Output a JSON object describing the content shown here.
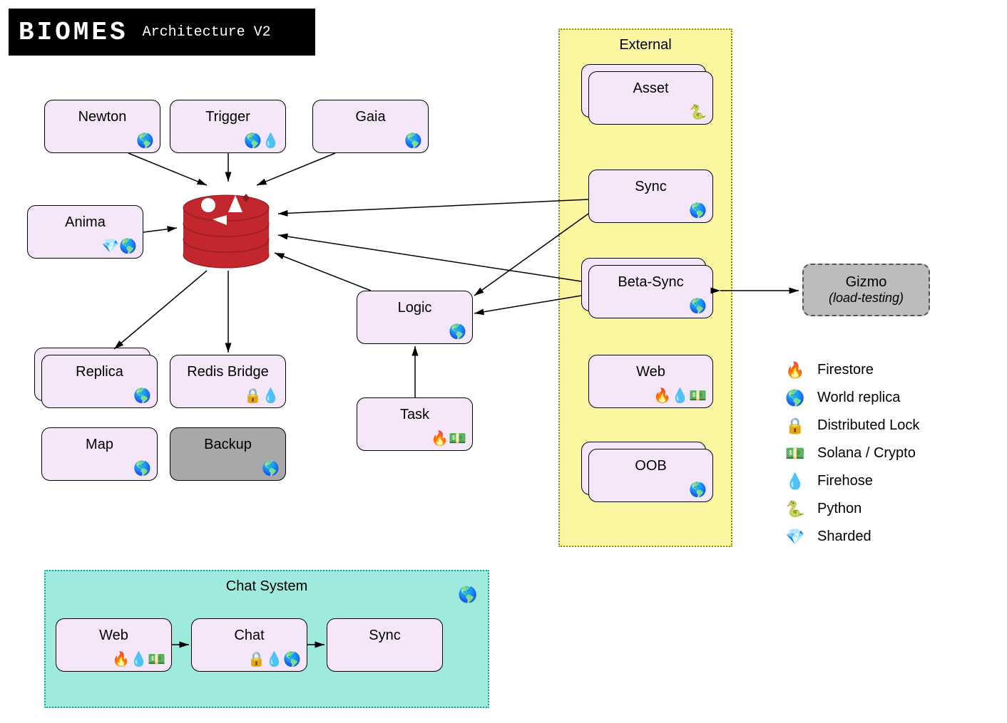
{
  "header": {
    "logo": "BIOMES",
    "subtitle": "Architecture V2"
  },
  "groups": {
    "external": "External",
    "chat": "Chat System"
  },
  "gizmo": {
    "title": "Gizmo",
    "subtitle": "(load-testing)"
  },
  "nodes": {
    "newton": {
      "label": "Newton",
      "icons": [
        "world"
      ]
    },
    "trigger": {
      "label": "Trigger",
      "icons": [
        "world",
        "firehose"
      ]
    },
    "gaia": {
      "label": "Gaia",
      "icons": [
        "world"
      ]
    },
    "anima": {
      "label": "Anima",
      "icons": [
        "sharded",
        "world"
      ]
    },
    "replica": {
      "label": "Replica",
      "icons": [
        "world"
      ]
    },
    "redisbridge": {
      "label": "Redis Bridge",
      "icons": [
        "lock",
        "firehose"
      ]
    },
    "map": {
      "label": "Map",
      "icons": [
        "world"
      ]
    },
    "backup": {
      "label": "Backup",
      "icons": [
        "world"
      ]
    },
    "logic": {
      "label": "Logic",
      "icons": [
        "world"
      ]
    },
    "task": {
      "label": "Task",
      "icons": [
        "firestore",
        "solana"
      ]
    },
    "asset": {
      "label": "Asset",
      "icons": [
        "python"
      ]
    },
    "sync": {
      "label": "Sync",
      "icons": [
        "world"
      ]
    },
    "betasync": {
      "label": "Beta-Sync",
      "icons": [
        "world"
      ]
    },
    "web_ext": {
      "label": "Web",
      "icons": [
        "firestore",
        "firehose",
        "solana"
      ]
    },
    "oob": {
      "label": "OOB",
      "icons": [
        "world"
      ]
    },
    "web_chat": {
      "label": "Web",
      "icons": [
        "firestore",
        "firehose",
        "solana"
      ]
    },
    "chat": {
      "label": "Chat",
      "icons": [
        "lock",
        "firehose",
        "world"
      ]
    },
    "sync_chat": {
      "label": "Sync",
      "icons": []
    }
  },
  "icon_glyphs": {
    "firestore": "🔥",
    "world": "🌎",
    "lock": "🔒",
    "solana": "💵",
    "firehose": "💧",
    "python": "🐍",
    "sharded": "💎"
  },
  "legend": [
    {
      "icon": "firestore",
      "label": "Firestore"
    },
    {
      "icon": "world",
      "label": "World replica"
    },
    {
      "icon": "lock",
      "label": "Distributed Lock"
    },
    {
      "icon": "solana",
      "label": "Solana / Crypto"
    },
    {
      "icon": "firehose",
      "label": "Firehose"
    },
    {
      "icon": "python",
      "label": "Python"
    },
    {
      "icon": "sharded",
      "label": "Sharded"
    }
  ]
}
